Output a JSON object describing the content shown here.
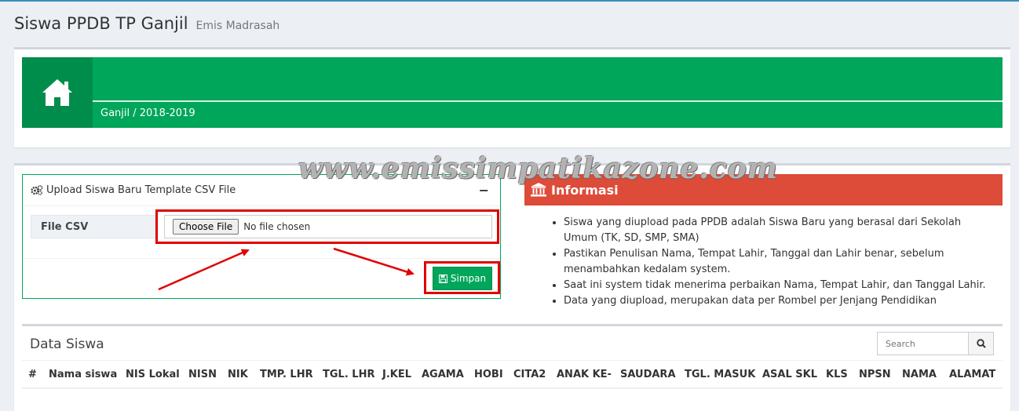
{
  "header": {
    "title": "Siswa PPDB TP Ganjil",
    "subtitle": "Emis Madrasah"
  },
  "banner": {
    "icon": "home-icon",
    "period": "Ganjil / 2018-2019",
    "color": "#00a65a"
  },
  "watermark": "www.emissimpatikazone.com",
  "upload": {
    "title": "Upload Siswa Baru Template CSV File",
    "collapse_label": "−",
    "file_label": "File CSV",
    "choose_button": "Choose File",
    "no_file_text": "No file chosen",
    "save_button": "Simpan"
  },
  "info": {
    "title": "Informasi",
    "color": "#dd4b39",
    "items": [
      "Siswa yang diupload pada PPDB adalah Siswa Baru yang berasal dari Sekolah Umum (TK, SD, SMP, SMA)",
      "Pastikan Penulisan Nama, Tempat Lahir, Tanggal dan Lahir benar, sebelum menambahkan kedalam system.",
      "Saat ini system tidak menerima perbaikan Nama, Tempat Lahir, dan Tanggal Lahir.",
      "Data yang diupload, merupakan data per Rombel per Jenjang Pendidikan"
    ]
  },
  "data_table": {
    "title": "Data Siswa",
    "search_placeholder": "Search",
    "columns": [
      "#",
      "Nama siswa",
      "NIS Lokal",
      "NISN",
      "NIK",
      "TMP. LHR",
      "TGL. LHR",
      "J.KEL",
      "AGAMA",
      "HOBI",
      "CITA2",
      "ANAK KE-",
      "SAUDARA",
      "TGL. MASUK",
      "ASAL SKL",
      "KLS",
      "NPSN",
      "NAMA",
      "ALAMAT"
    ]
  }
}
